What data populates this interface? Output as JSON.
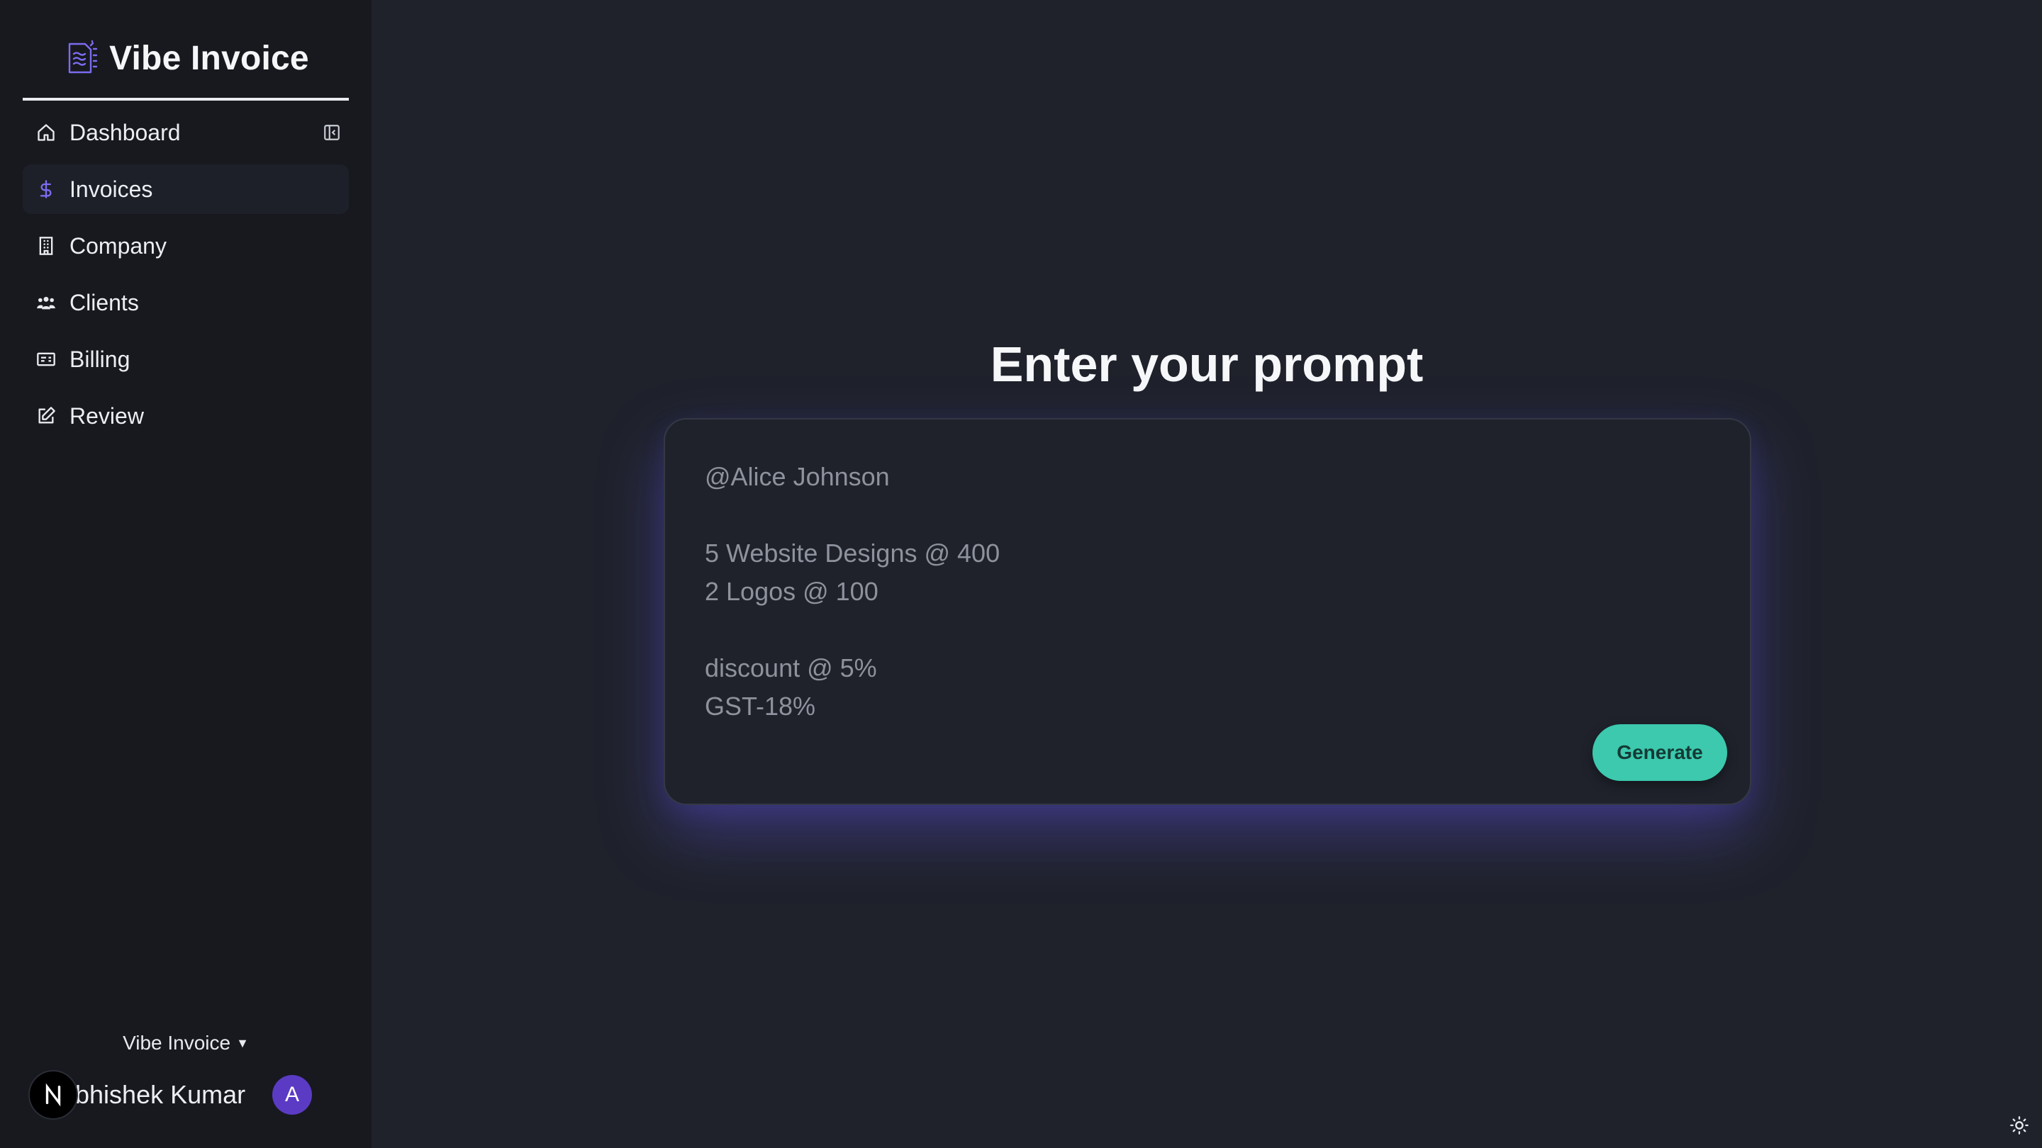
{
  "brand": {
    "title": "Vibe Invoice",
    "icon": "invoice-icon",
    "accent": "#7c6cf0"
  },
  "sidebar": {
    "items": [
      {
        "label": "Dashboard",
        "icon": "home-icon"
      },
      {
        "label": "Invoices",
        "icon": "dollar-icon",
        "active": true
      },
      {
        "label": "Company",
        "icon": "building-icon"
      },
      {
        "label": "Clients",
        "icon": "users-icon"
      },
      {
        "label": "Billing",
        "icon": "billing-icon"
      },
      {
        "label": "Review",
        "icon": "edit-icon"
      }
    ],
    "collapse_icon": "sidebar-collapse-icon",
    "org_switcher": {
      "label": "Vibe Invoice",
      "icon": "caret-down-icon"
    },
    "user": {
      "badge": "N",
      "name": "bhishek Kumar",
      "avatar_initial": "A"
    }
  },
  "main": {
    "title": "Enter your prompt",
    "prompt": {
      "value": "@Alice Johnson\n\n5 Website Designs @ 400\n2 Logos @ 100\n\ndiscount @ 5%\nGST-18%"
    },
    "generate_label": "Generate",
    "generate_color": "#3cc9ae"
  },
  "theme_toggle_icon": "sun-icon"
}
